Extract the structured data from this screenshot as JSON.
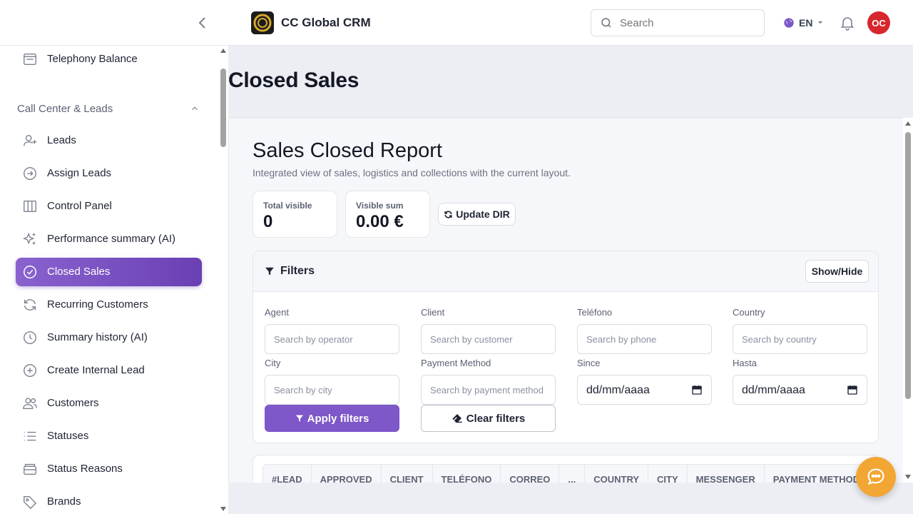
{
  "header": {
    "app_title": "CC Global CRM",
    "search_placeholder": "Search",
    "language": "EN",
    "avatar_initials": "OC"
  },
  "sidebar": {
    "top_item": "Telephony Balance",
    "section_title": "Call Center & Leads",
    "items": [
      {
        "label": "Leads",
        "icon": "user-plus-icon"
      },
      {
        "label": "Assign Leads",
        "icon": "arrow-circle-icon"
      },
      {
        "label": "Control Panel",
        "icon": "columns-icon"
      },
      {
        "label": "Performance summary (AI)",
        "icon": "sparkles-icon"
      },
      {
        "label": "Closed Sales",
        "icon": "check-circle-icon",
        "active": true
      },
      {
        "label": "Recurring Customers",
        "icon": "refresh-icon"
      },
      {
        "label": "Summary history (AI)",
        "icon": "clock-icon"
      },
      {
        "label": "Create Internal Lead",
        "icon": "plus-circle-icon"
      },
      {
        "label": "Customers",
        "icon": "users-icon"
      },
      {
        "label": "Statuses",
        "icon": "list-icon"
      },
      {
        "label": "Status Reasons",
        "icon": "archive-icon"
      },
      {
        "label": "Brands",
        "icon": "tag-icon"
      }
    ]
  },
  "page": {
    "title": "Closed Sales",
    "report_title": "Sales Closed Report",
    "report_subtitle": "Integrated view of sales, logistics and collections with the current layout.",
    "stats": {
      "total_label": "Total visible",
      "total_value": "0",
      "sum_label": "Visible sum",
      "sum_value": "0.00 €"
    },
    "update_button": "Update DIR"
  },
  "filters": {
    "title": "Filters",
    "toggle_button": "Show/Hide",
    "agent_label": "Agent",
    "agent_placeholder": "Search by operator",
    "client_label": "Client",
    "client_placeholder": "Search by customer",
    "phone_label": "Teléfono",
    "phone_placeholder": "Search by phone",
    "country_label": "Country",
    "country_placeholder": "Search by country",
    "city_label": "City",
    "city_placeholder": "Search by city",
    "payment_label": "Payment Method",
    "payment_placeholder": "Search by payment method",
    "since_label": "Since",
    "since_value": "dd/mm/aaaa",
    "until_label": "Hasta",
    "until_value": "dd/mm/aaaa",
    "apply_button": "Apply filters",
    "clear_button": "Clear filters"
  },
  "table": {
    "columns": [
      "#LEAD",
      "APPROVED",
      "CLIENT",
      "TELÉFONO",
      "CORREO",
      "...",
      "COUNTRY",
      "CITY",
      "MESSENGER",
      "PAYMENT METHOD"
    ]
  },
  "colors": {
    "accent": "#7e57c8",
    "avatar_bg": "#d7262c",
    "chat_fab": "#f2a634"
  }
}
